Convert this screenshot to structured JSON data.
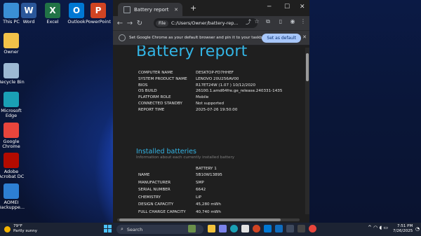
{
  "desktop": {
    "icons": [
      {
        "label": "This PC",
        "icon": "this-pc-icon",
        "color": "#3a8fd6"
      },
      {
        "label": "Word",
        "icon": "word-icon",
        "color": "#2b579a",
        "letter": "W"
      },
      {
        "label": "Excel",
        "icon": "excel-icon",
        "color": "#217346",
        "letter": "X"
      },
      {
        "label": "Outlook",
        "icon": "outlook-icon",
        "color": "#0078d4",
        "letter": "O"
      },
      {
        "label": "PowerPoint",
        "icon": "powerpoint-icon",
        "color": "#d04423",
        "letter": "P"
      },
      {
        "label": "Owner",
        "icon": "folder-icon",
        "color": "#f2c249"
      },
      {
        "label": "Recycle Bin",
        "icon": "recycle-bin-icon",
        "color": "#9db9d4"
      },
      {
        "label": "Microsoft Edge",
        "icon": "edge-icon",
        "color": "#1aa0b5"
      },
      {
        "label": "Google Chrome",
        "icon": "chrome-icon",
        "color": "#e8453c"
      },
      {
        "label": "Adobe Acrobat DC",
        "icon": "acrobat-icon",
        "color": "#b30b00"
      },
      {
        "label": "AOMEI Backuppe...",
        "icon": "aomei-icon",
        "color": "#2d7fd3"
      }
    ]
  },
  "browser": {
    "tab_title": "Battery report",
    "address_chip": "File",
    "address": "C:/Users/Owner/battery-rep...",
    "infobar_text": "Set Google Chrome as your default browser and pin it to your taskbar",
    "set_default_label": "Set as default"
  },
  "report": {
    "title": "Battery report",
    "system_info": [
      {
        "key": "COMPUTER NAME",
        "value": "DESKTOP-FD7HHEF"
      },
      {
        "key": "SYSTEM PRODUCT NAME",
        "value": "LENOVO 20U256AV00"
      },
      {
        "key": "BIOS",
        "value": "R17ET24W (1.07 ) 10/12/2020"
      },
      {
        "key": "OS BUILD",
        "value": "26100.1.amd64fre.ge_release.240331-1435"
      },
      {
        "key": "PLATFORM ROLE",
        "value": "Mobile"
      },
      {
        "key": "CONNECTED STANDBY",
        "value": "Not supported"
      },
      {
        "key": "REPORT TIME",
        "value": "2025-07-26   19:50:00"
      }
    ],
    "installed_title": "Installed batteries",
    "installed_subtitle": "Information about each currently installed battery",
    "battery_column": "BATTERY 1",
    "battery_rows": [
      {
        "key": "NAME",
        "value": "5B10W13895"
      },
      {
        "key": "MANUFACTURER",
        "value": "SMP"
      },
      {
        "key": "SERIAL NUMBER",
        "value": "6642"
      },
      {
        "key": "CHEMISTRY",
        "value": "LiP"
      },
      {
        "key": "DESIGN CAPACITY",
        "value": "45,280 mWh"
      },
      {
        "key": "FULL CHARGE CAPACITY",
        "value": "40,740 mWh"
      }
    ]
  },
  "taskbar": {
    "weather_temp": "79°F",
    "weather_desc": "Partly sunny",
    "search_placeholder": "Search",
    "time": "7:51 PM",
    "date": "7/26/2025"
  }
}
